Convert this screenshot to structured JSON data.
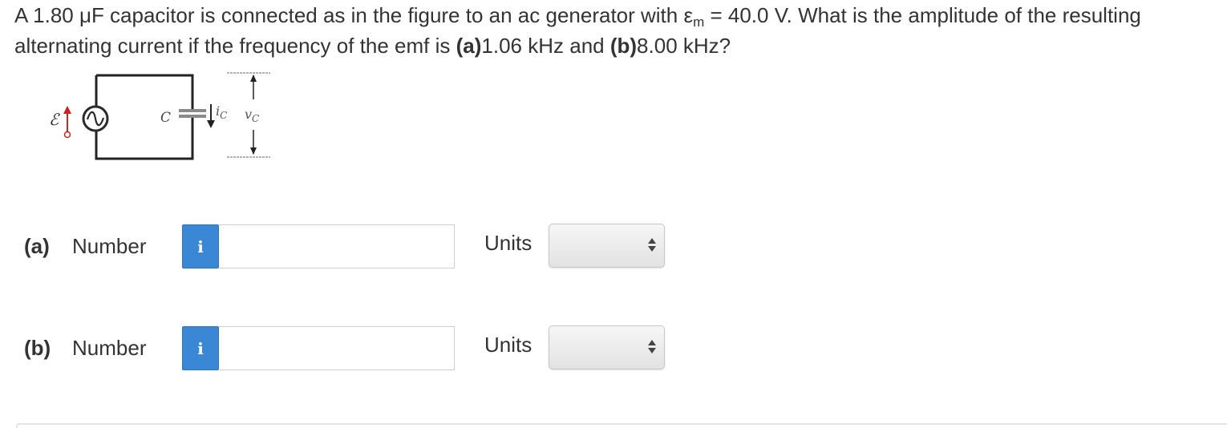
{
  "question": {
    "text_1": "A 1.80 μF capacitor is connected as in the figure to an ac generator with ε",
    "emf_sub": "m",
    "text_2": " = 40.0 V. What is the amplitude of the resulting alternating current if the frequency of the emf is ",
    "part_a_tag": "(a)",
    "part_a_value": "1.06 kHz and ",
    "part_b_tag": "(b)",
    "part_b_value": "8.00 kHz?"
  },
  "figure": {
    "emf_symbol": "ℰ",
    "capacitor_label": "C",
    "current_label": "i",
    "current_sub": "C",
    "voltage_label": "v",
    "voltage_sub": "C",
    "colors": {
      "wire": "#222222",
      "emf_arrow": "#cc2222",
      "generator": "#2a2a2a"
    }
  },
  "answers": [
    {
      "part": "(a)",
      "number_label": "Number",
      "info_icon": "i",
      "number_value": "",
      "units_label": "Units",
      "units_value": ""
    },
    {
      "part": "(b)",
      "number_label": "Number",
      "info_icon": "i",
      "number_value": "",
      "units_label": "Units",
      "units_value": ""
    }
  ],
  "colors": {
    "info_button": "#3a87d6",
    "text": "#333333"
  }
}
